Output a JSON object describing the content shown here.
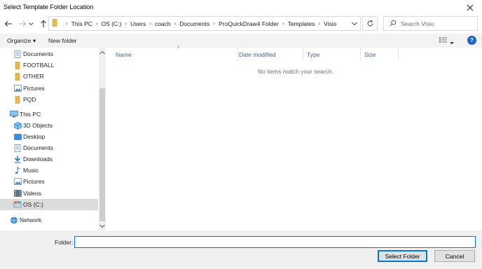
{
  "window": {
    "title": "Select Template Folder Location"
  },
  "address": {
    "crumbs": [
      "This PC",
      "OS (C:)",
      "Users",
      "coach",
      "Documents",
      "ProQuickDraw4 Folder",
      "Templates",
      "Visio"
    ]
  },
  "search": {
    "placeholder": "Search Visio"
  },
  "toolbar": {
    "organize": "Organize ▾",
    "new_folder": "New folder",
    "help": "?"
  },
  "nav": {
    "items": [
      {
        "label": "Documents",
        "icon": "documents-icon"
      },
      {
        "label": "FOOTBALL",
        "icon": "folder-icon"
      },
      {
        "label": "OTHER",
        "icon": "folder-icon"
      },
      {
        "label": "Pictures",
        "icon": "pictures-icon"
      },
      {
        "label": "PQD",
        "icon": "folder-icon"
      },
      {
        "label": "This PC",
        "icon": "pc-icon"
      },
      {
        "label": "3D Objects",
        "icon": "3d-objects-icon"
      },
      {
        "label": "Desktop",
        "icon": "desktop-icon"
      },
      {
        "label": "Documents",
        "icon": "documents-icon"
      },
      {
        "label": "Downloads",
        "icon": "downloads-icon"
      },
      {
        "label": "Music",
        "icon": "music-icon"
      },
      {
        "label": "Pictures",
        "icon": "pictures-icon"
      },
      {
        "label": "Videos",
        "icon": "videos-icon"
      },
      {
        "label": "OS (C:)",
        "icon": "drive-icon"
      },
      {
        "label": "Network",
        "icon": "network-icon"
      }
    ],
    "selected": "OS (C:)"
  },
  "columns": [
    "Name",
    "Date modified",
    "Type",
    "Size"
  ],
  "empty_message": "No items match your search.",
  "footer": {
    "folder_label": "Folder:",
    "folder_value": "",
    "select_button": "Select Folder",
    "cancel_button": "Cancel"
  },
  "colors": {
    "accent": "#0078d7",
    "folder": "#e8b84a",
    "help": "#1a67c9"
  }
}
